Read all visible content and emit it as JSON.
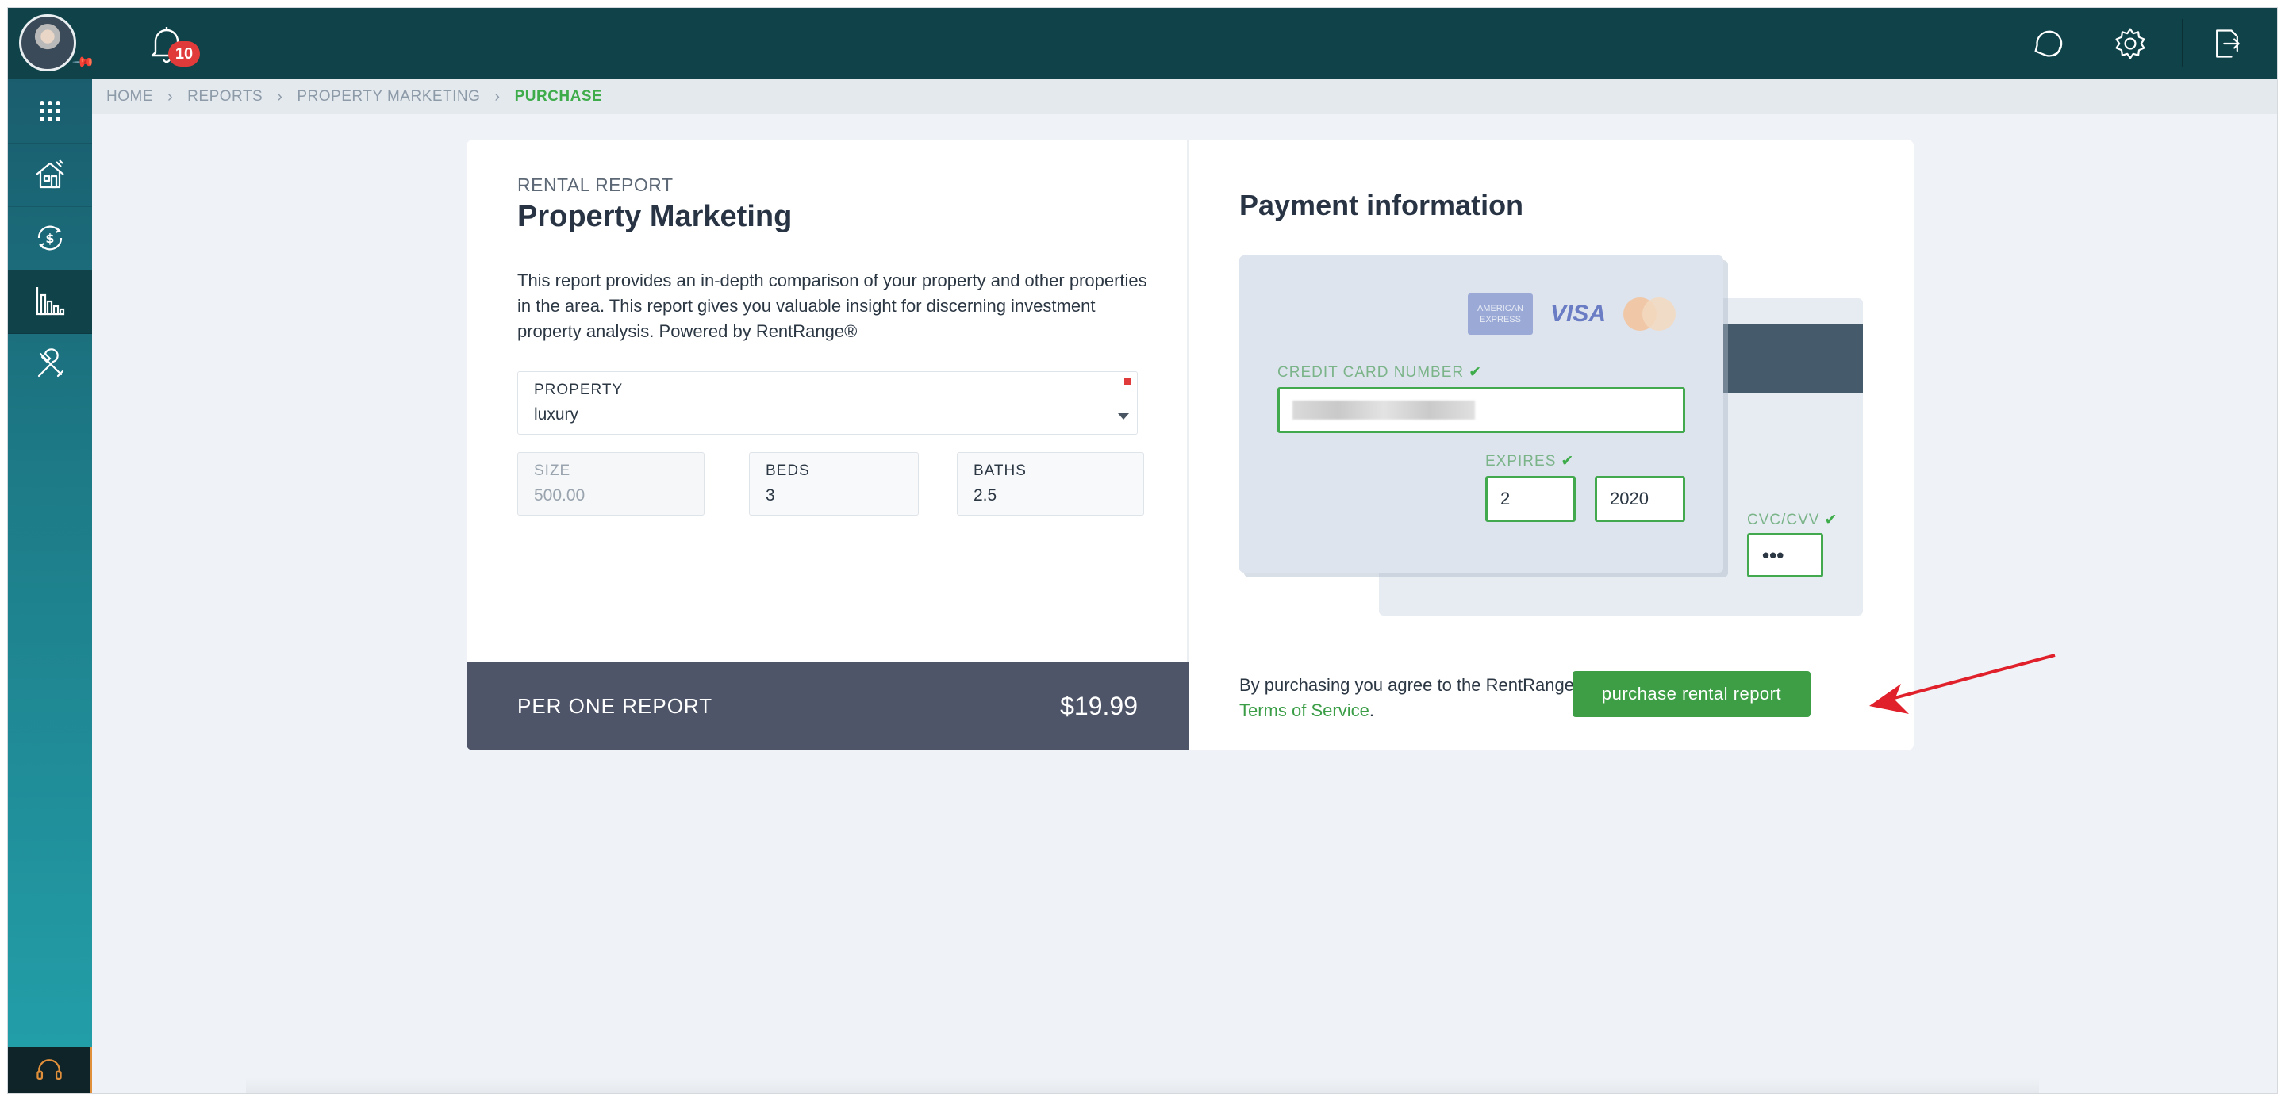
{
  "notifications": {
    "count": "10"
  },
  "breadcrumb": [
    "HOME",
    "REPORTS",
    "PROPERTY MARKETING",
    "PURCHASE"
  ],
  "sidebar": {
    "items": [
      {
        "icon": "apps-grid-icon"
      },
      {
        "icon": "house-icon"
      },
      {
        "icon": "dollar-cycle-icon"
      },
      {
        "icon": "bar-chart-icon",
        "active": true
      },
      {
        "icon": "tools-icon"
      }
    ],
    "support_icon": "headset-icon"
  },
  "topbar": {
    "icons": [
      "chat-icon",
      "gear-icon",
      "logout-icon"
    ]
  },
  "report": {
    "eyebrow": "RENTAL REPORT",
    "title": "Property Marketing",
    "description": "This report provides an in-depth comparison of your property and other properties in the area. This report gives you valuable insight for discerning investment property analysis. Powered by RentRange®",
    "property_label": "PROPERTY",
    "property_value": "luxury",
    "size_label": "SIZE",
    "size_value": "500.00",
    "beds_label": "BEDS",
    "beds_value": "3",
    "baths_label": "BATHS",
    "baths_value": "2.5",
    "per_label": "PER ONE REPORT",
    "price": "$19.99"
  },
  "payment": {
    "title": "Payment information",
    "brands": [
      "AMERICAN EXPRESS",
      "VISA",
      "mastercard"
    ],
    "cc_label": "CREDIT CARD NUMBER",
    "expires_label": "EXPIRES",
    "exp_month": "2",
    "exp_year": "2020",
    "cvc_label": "CVC/CVV",
    "cvc_value": "•••",
    "agree_text": "By purchasing you agree to the RentRange",
    "tos_link": "Terms of Service",
    "button": "purchase rental report"
  },
  "colors": {
    "accent_green": "#3e9e46",
    "header_dark": "#0f4349",
    "badge_red": "#e03a3a",
    "price_bar": "#4e5568"
  }
}
